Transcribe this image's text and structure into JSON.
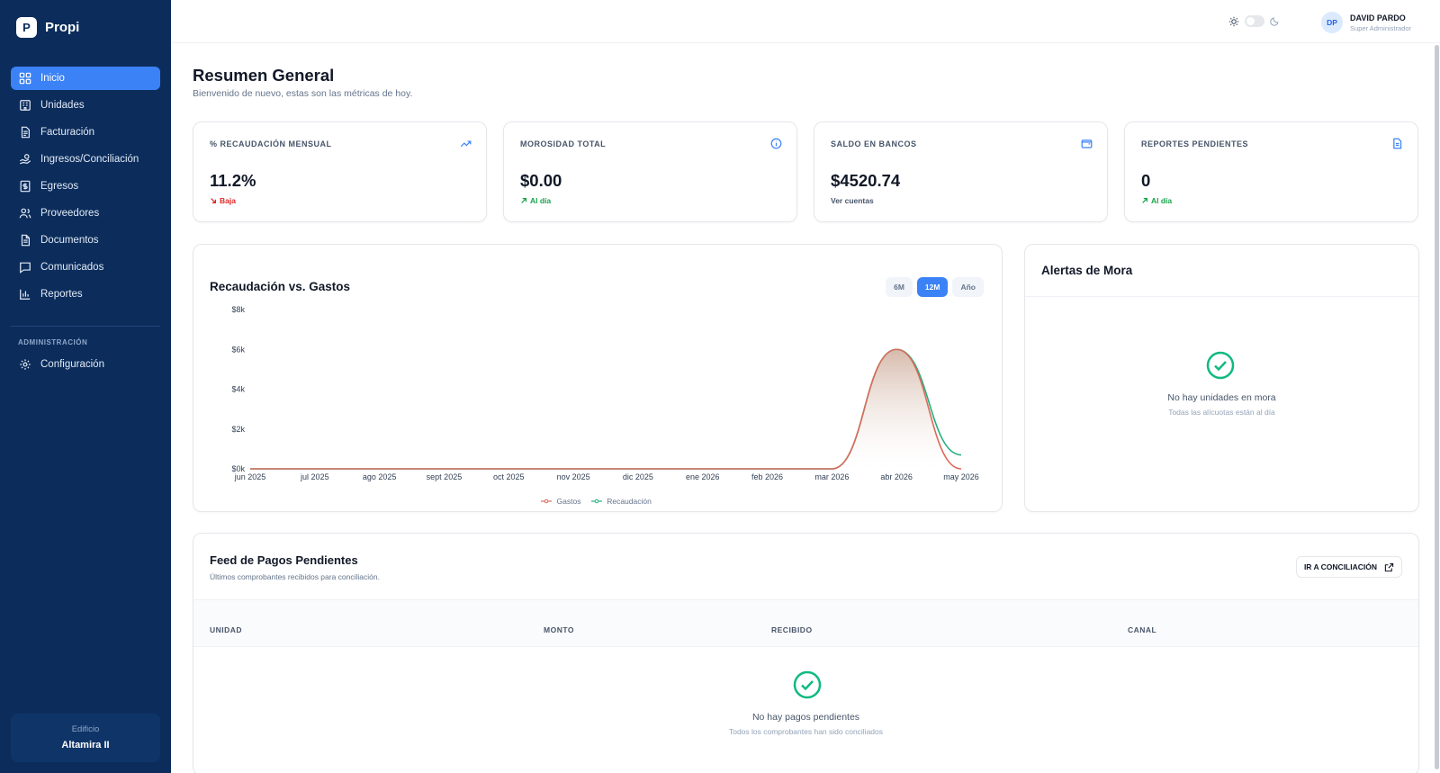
{
  "brand": {
    "logo_letter": "P",
    "name": "Propi"
  },
  "sidebar": {
    "items": [
      {
        "label": "Inicio",
        "icon": "grid-icon",
        "active": true
      },
      {
        "label": "Unidades",
        "icon": "building-icon"
      },
      {
        "label": "Facturación",
        "icon": "invoice-icon"
      },
      {
        "label": "Ingresos/Conciliación",
        "icon": "hand-coins-icon"
      },
      {
        "label": "Egresos",
        "icon": "receipt-icon"
      },
      {
        "label": "Proveedores",
        "icon": "users-icon"
      },
      {
        "label": "Documentos",
        "icon": "document-icon"
      },
      {
        "label": "Comunicados",
        "icon": "message-icon"
      },
      {
        "label": "Reportes",
        "icon": "bar-chart-icon"
      }
    ],
    "admin_section": "ADMINISTRACIÓN",
    "admin_items": [
      {
        "label": "Configuración",
        "icon": "gear-icon"
      }
    ],
    "building_label": "Edificio",
    "building_name": "Altamira II"
  },
  "header": {
    "user_initials": "DP",
    "user_name": "DAVID PARDO",
    "user_role": "Super Administrador"
  },
  "page": {
    "title": "Resumen General",
    "subtitle": "Bienvenido de nuevo, estas son las métricas de hoy."
  },
  "kpis": [
    {
      "label": "% RECAUDACIÓN MENSUAL",
      "value": "11.2%",
      "sub": "Baja",
      "sub_color": "#dc2626",
      "icon": "trend-up-icon"
    },
    {
      "label": "MOROSIDAD TOTAL",
      "value": "$0.00",
      "sub": "Al día",
      "sub_color": "#16a34a",
      "icon": "info-icon"
    },
    {
      "label": "SALDO EN BANCOS",
      "value": "$4520.74",
      "sub": "Ver cuentas",
      "sub_color": "#475569",
      "icon": "wallet-icon"
    },
    {
      "label": "REPORTES PENDIENTES",
      "value": "0",
      "sub": "Al día",
      "sub_color": "#16a34a",
      "icon": "file-icon"
    }
  ],
  "chart_card": {
    "title": "Recaudación vs. Gastos",
    "ranges": [
      {
        "label": "6M"
      },
      {
        "label": "12M",
        "active": true
      },
      {
        "label": "Año"
      }
    ]
  },
  "chart_data": {
    "type": "area",
    "title": "Recaudación vs. Gastos",
    "categories": [
      "jun 2025",
      "jul 2025",
      "ago 2025",
      "sept 2025",
      "oct 2025",
      "nov 2025",
      "dic 2025",
      "ene 2026",
      "feb 2026",
      "mar 2026",
      "abr 2026",
      "may 2026"
    ],
    "series": [
      {
        "name": "Gastos",
        "color": "#dc6b5b",
        "values": [
          0,
          0,
          0,
          0,
          0,
          0,
          0,
          0,
          0,
          0,
          6000,
          0
        ]
      },
      {
        "name": "Recaudación",
        "color": "#22b07d",
        "values": [
          0,
          0,
          0,
          0,
          0,
          0,
          0,
          0,
          0,
          0,
          6000,
          700
        ]
      }
    ],
    "y_ticks": [
      "$0k",
      "$2k",
      "$4k",
      "$6k",
      "$8k"
    ],
    "ylim": [
      0,
      8000
    ],
    "grid": false,
    "legend": "bottom-center"
  },
  "alerts": {
    "title": "Alertas de Mora",
    "empty_title": "No hay unidades en mora",
    "empty_sub": "Todas las alícuotas están al día"
  },
  "feed": {
    "title": "Feed de Pagos Pendientes",
    "subtitle": "Últimos comprobantes recibidos para conciliación.",
    "button": "IR A CONCILIACIÓN",
    "columns": [
      "UNIDAD",
      "MONTO",
      "RECIBIDO",
      "CANAL"
    ],
    "empty_title": "No hay pagos pendientes",
    "empty_sub": "Todos los comprobantes han sido conciliados"
  }
}
